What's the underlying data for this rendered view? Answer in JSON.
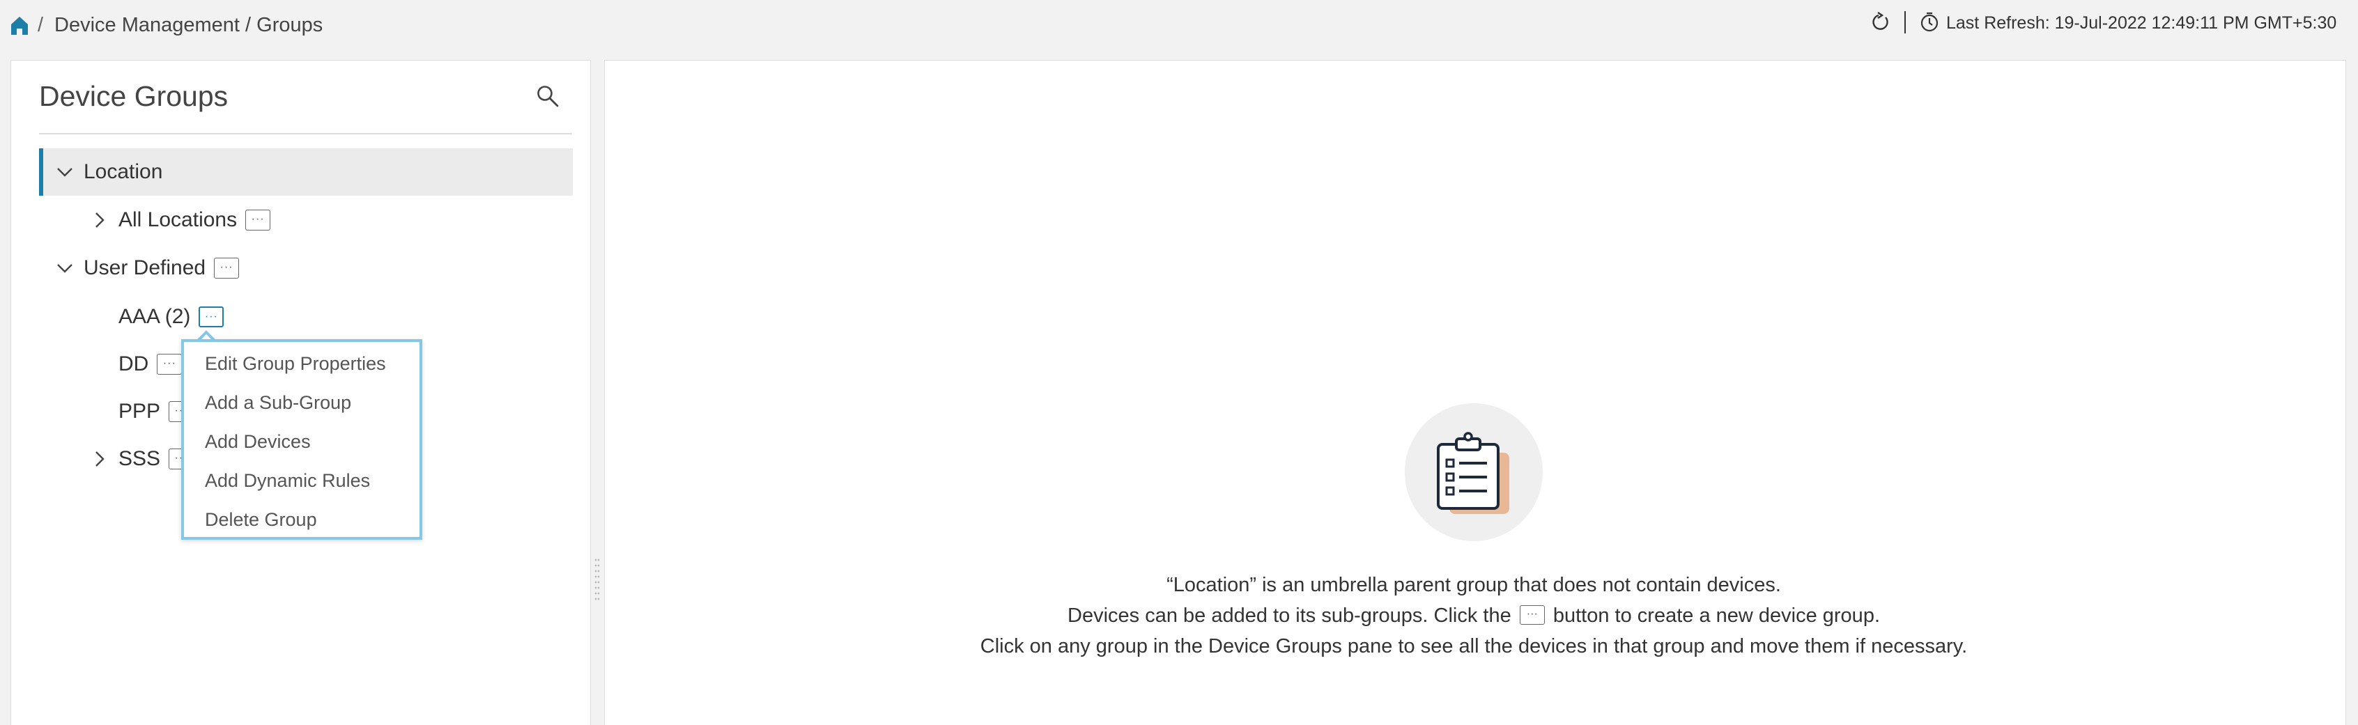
{
  "breadcrumb": {
    "separator": "/",
    "path": "Device Management / Groups"
  },
  "header": {
    "last_refresh": "Last Refresh: 19-Jul-2022 12:49:11 PM GMT+5:30"
  },
  "left_pane": {
    "title": "Device Groups",
    "tree": {
      "location": "Location",
      "all_locations": "All Locations",
      "user_defined": "User Defined",
      "aaa": "AAA (2)",
      "dd": "DD",
      "ppp": "PPP",
      "sss": "SSS"
    },
    "more_glyph": "···"
  },
  "context_menu": {
    "items": [
      "Edit Group Properties",
      "Add a Sub-Group",
      "Add Devices",
      "Add Dynamic Rules",
      "Delete Group"
    ]
  },
  "empty_state": {
    "line1": "“Location” is an umbrella parent group that does not contain devices.",
    "line2_before": "Devices can be added to its sub-groups. Click the",
    "line2_after": "button to create a new device group.",
    "line3": "Click on any group in the Device Groups pane to see all the devices in that group and move them if necessary."
  },
  "colors": {
    "accent": "#1d7ea7",
    "menu_border": "#84c7e6",
    "clipboard_back": "#e8b896"
  }
}
